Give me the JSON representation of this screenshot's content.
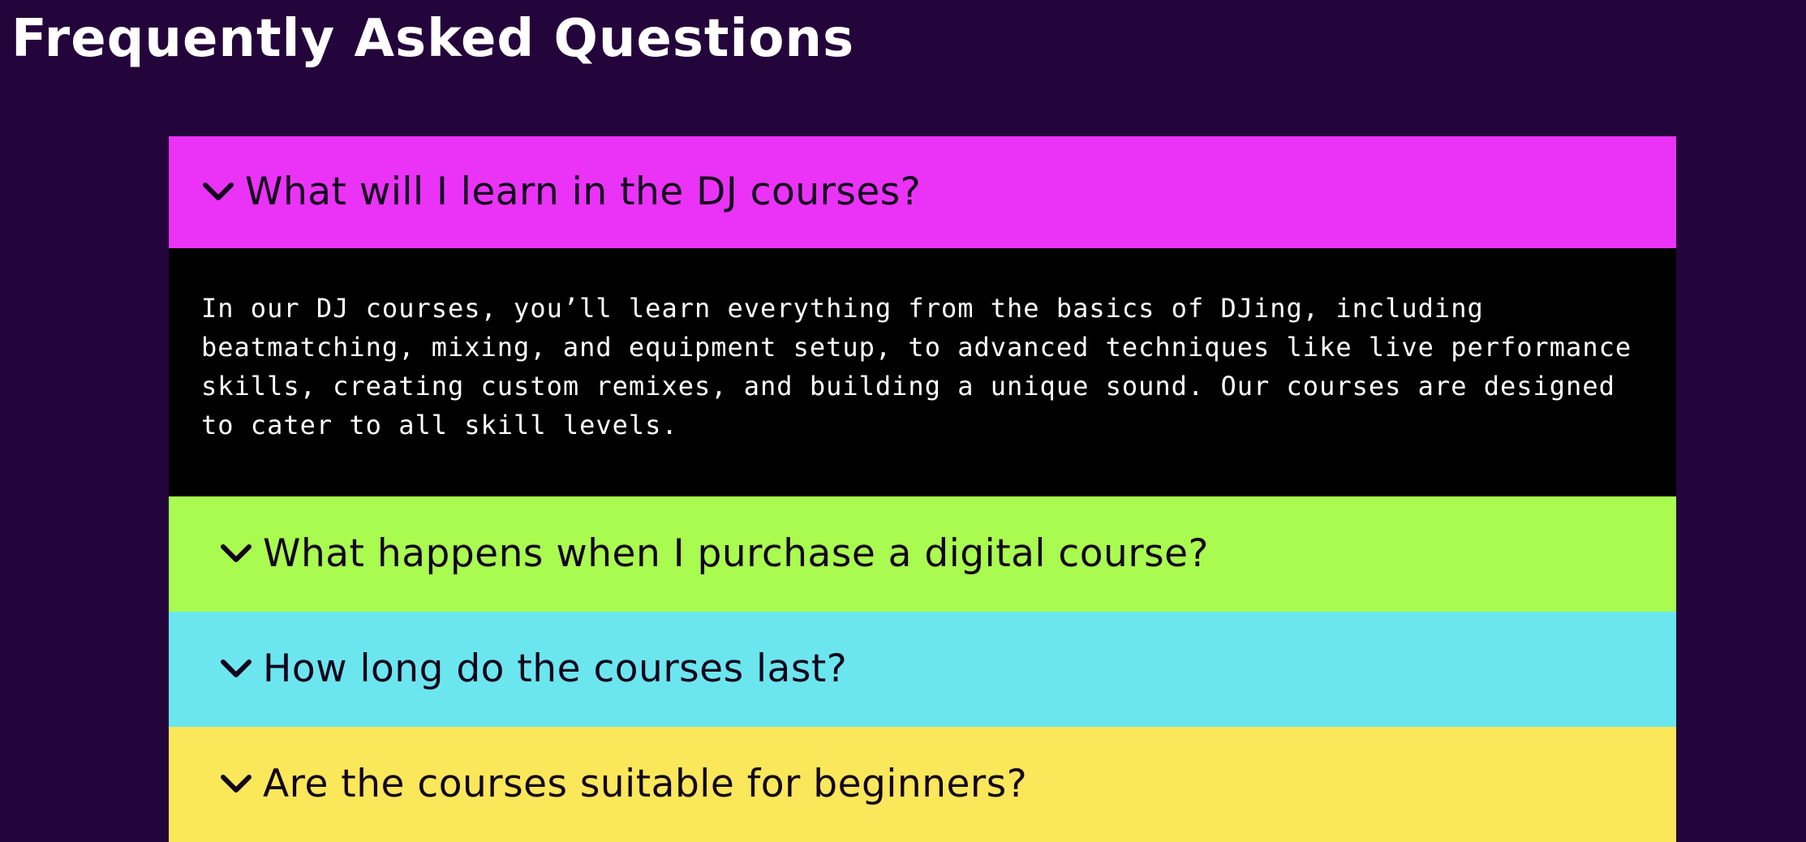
{
  "page": {
    "title": "Frequently Asked Questions"
  },
  "faq": {
    "items": [
      {
        "question": "What will I learn in the DJ courses?",
        "answer": "In our DJ courses, you’ll learn everything from the basics of DJing, including beatmatching, mixing, and equipment setup, to advanced techniques like live performance skills, creating custom remixes, and building a unique sound. Our courses are designed to cater to all skill levels.",
        "expanded": true,
        "color": "#ea33f7"
      },
      {
        "question": "What happens when I purchase a digital course?",
        "expanded": false,
        "color": "#a9fb50"
      },
      {
        "question": "How long do the courses last?",
        "expanded": false,
        "color": "#6be6ee"
      },
      {
        "question": "Are the courses suitable for beginners?",
        "expanded": false,
        "color": "#fbe75a"
      }
    ]
  },
  "icons": {
    "toggle": "chevron-down-icon"
  },
  "colors": {
    "background": "#24053b",
    "answer_background": "#000000",
    "title_text": "#ffffff",
    "question_text": "#12041c"
  }
}
